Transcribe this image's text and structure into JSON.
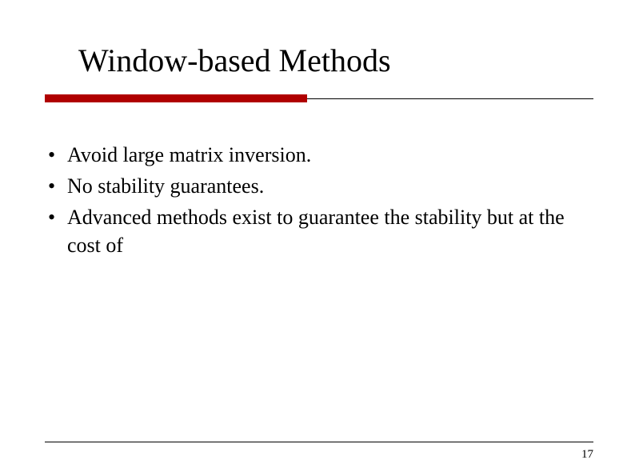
{
  "slide": {
    "title": "Window-based Methods",
    "bullets": [
      "Avoid large matrix inversion.",
      "No stability guarantees.",
      "Advanced methods exist to guarantee the stability but at the cost of"
    ],
    "page_number": "17"
  },
  "colors": {
    "accent": "#b00000"
  }
}
